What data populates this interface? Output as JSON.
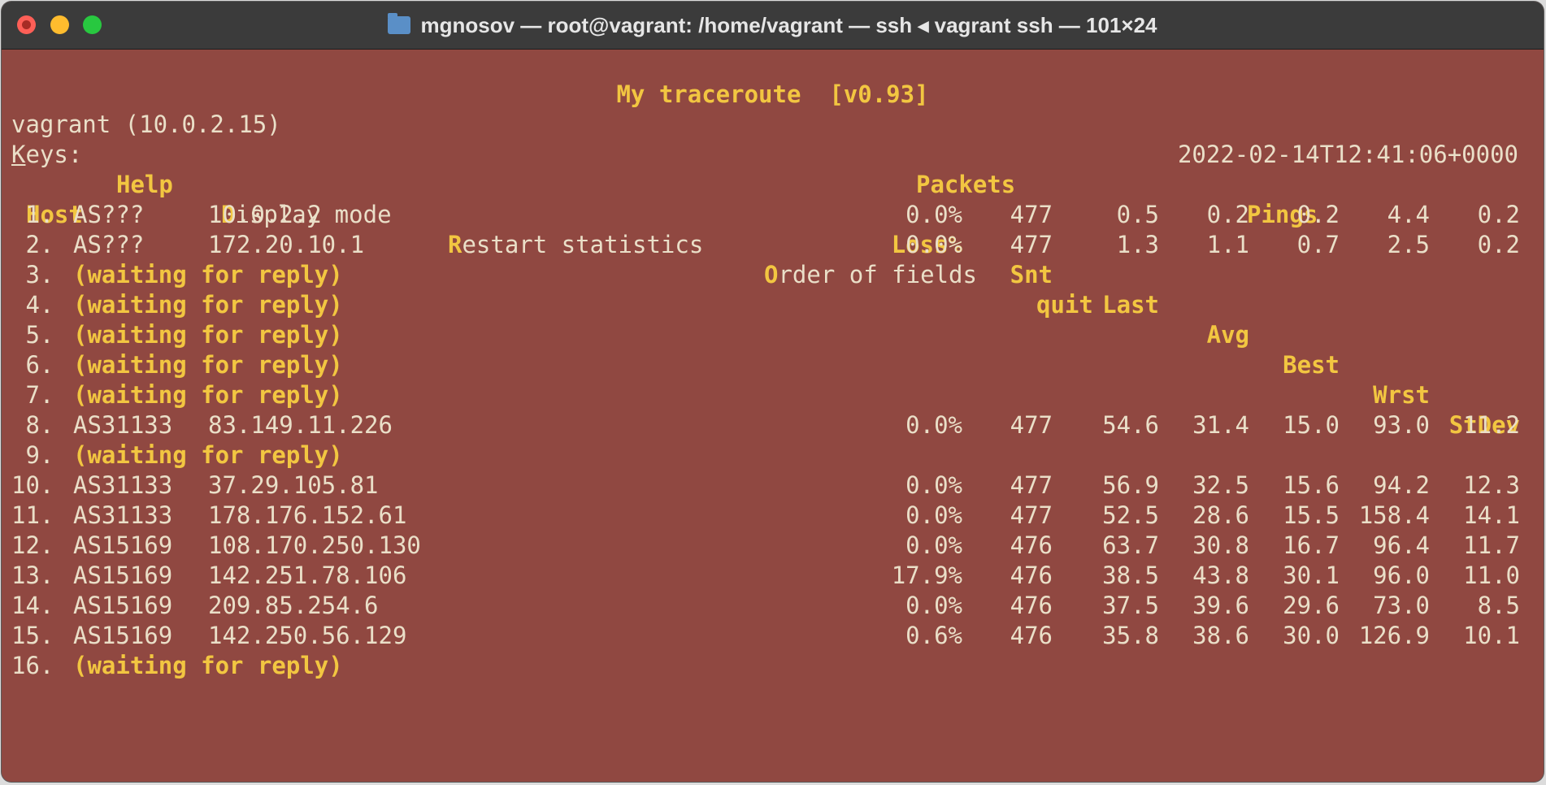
{
  "window": {
    "title": "mgnosov — root@vagrant: /home/vagrant — ssh ◂ vagrant ssh — 101×24"
  },
  "mtr": {
    "title": "My traceroute  [v0.93]",
    "host_label": "vagrant (10.0.2.15)",
    "timestamp": "2022-02-14T12:41:06+0000",
    "keys": {
      "label_first": "K",
      "label_rest": "eys:",
      "help_key": "H",
      "help_rest": "elp",
      "display_key": "D",
      "display_rest": "isplay mode",
      "restart_key": "R",
      "restart_rest": "estart statistics",
      "order_key": "O",
      "order_rest": "rder of fields",
      "quit_key": "q",
      "quit_rest": "uit"
    },
    "group_headers": {
      "packets": "Packets",
      "pings": "Pings"
    },
    "columns": {
      "host": "Host",
      "loss": "Loss%",
      "snt": "Snt",
      "last": "Last",
      "avg": "Avg",
      "best": "Best",
      "wrst": "Wrst",
      "stdev": "StDev"
    },
    "hops": [
      {
        "num": " 1.",
        "as": "AS???",
        "ip": "10.0.2.2",
        "loss": "0.0%",
        "snt": "477",
        "last": "0.5",
        "avg": "0.2",
        "best": "0.2",
        "wrst": "4.4",
        "stdev": "0.2"
      },
      {
        "num": " 2.",
        "as": "AS???",
        "ip": "172.20.10.1",
        "loss": "0.0%",
        "snt": "477",
        "last": "1.3",
        "avg": "1.1",
        "best": "0.7",
        "wrst": "2.5",
        "stdev": "0.2"
      },
      {
        "num": " 3.",
        "waiting": "(waiting for reply)"
      },
      {
        "num": " 4.",
        "waiting": "(waiting for reply)"
      },
      {
        "num": " 5.",
        "waiting": "(waiting for reply)"
      },
      {
        "num": " 6.",
        "waiting": "(waiting for reply)"
      },
      {
        "num": " 7.",
        "waiting": "(waiting for reply)"
      },
      {
        "num": " 8.",
        "as": "AS31133",
        "ip": "83.149.11.226",
        "loss": "0.0%",
        "snt": "477",
        "last": "54.6",
        "avg": "31.4",
        "best": "15.0",
        "wrst": "93.0",
        "stdev": "11.2"
      },
      {
        "num": " 9.",
        "waiting": "(waiting for reply)"
      },
      {
        "num": "10.",
        "as": "AS31133",
        "ip": "37.29.105.81",
        "loss": "0.0%",
        "snt": "477",
        "last": "56.9",
        "avg": "32.5",
        "best": "15.6",
        "wrst": "94.2",
        "stdev": "12.3"
      },
      {
        "num": "11.",
        "as": "AS31133",
        "ip": "178.176.152.61",
        "loss": "0.0%",
        "snt": "477",
        "last": "52.5",
        "avg": "28.6",
        "best": "15.5",
        "wrst": "158.4",
        "stdev": "14.1"
      },
      {
        "num": "12.",
        "as": "AS15169",
        "ip": "108.170.250.130",
        "loss": "0.0%",
        "snt": "476",
        "last": "63.7",
        "avg": "30.8",
        "best": "16.7",
        "wrst": "96.4",
        "stdev": "11.7"
      },
      {
        "num": "13.",
        "as": "AS15169",
        "ip": "142.251.78.106",
        "loss": "17.9%",
        "snt": "476",
        "last": "38.5",
        "avg": "43.8",
        "best": "30.1",
        "wrst": "96.0",
        "stdev": "11.0"
      },
      {
        "num": "14.",
        "as": "AS15169",
        "ip": "209.85.254.6",
        "loss": "0.0%",
        "snt": "476",
        "last": "37.5",
        "avg": "39.6",
        "best": "29.6",
        "wrst": "73.0",
        "stdev": "8.5"
      },
      {
        "num": "15.",
        "as": "AS15169",
        "ip": "142.250.56.129",
        "loss": "0.6%",
        "snt": "476",
        "last": "35.8",
        "avg": "38.6",
        "best": "30.0",
        "wrst": "126.9",
        "stdev": "10.1"
      },
      {
        "num": "16.",
        "waiting": "(waiting for reply)"
      }
    ]
  }
}
